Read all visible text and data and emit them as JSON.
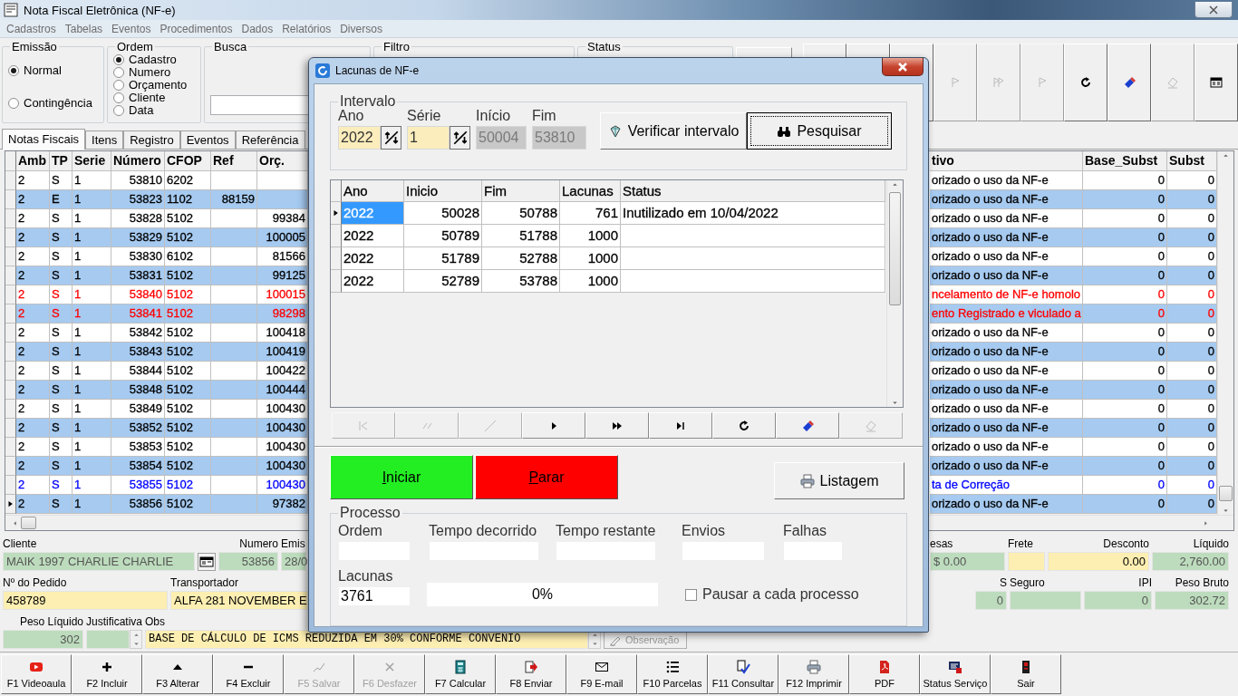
{
  "window": {
    "title": "Nota Fiscal Eletrônica (NF-e)"
  },
  "menu": [
    "Cadastros",
    "Tabelas",
    "Eventos",
    "Procedimentos",
    "Dados",
    "Relatórios",
    "Diversos"
  ],
  "emissao": {
    "label": "Emissão",
    "options": [
      {
        "label": "Normal",
        "selected": true
      },
      {
        "label": "Contingência",
        "selected": false
      }
    ]
  },
  "ordem": {
    "label": "Ordem",
    "options": [
      {
        "label": "Cadastro",
        "selected": true
      },
      {
        "label": "Numero",
        "selected": false
      },
      {
        "label": "Orçamento",
        "selected": false
      },
      {
        "label": "Cliente",
        "selected": false
      },
      {
        "label": "Data",
        "selected": false
      }
    ]
  },
  "busca": {
    "label": "Busca"
  },
  "filtro": {
    "label": "Filtro"
  },
  "status": {
    "label": "Status"
  },
  "nav_buttons": [
    {
      "disabled": true
    },
    {
      "disabled": true
    },
    {
      "disabled": true
    },
    {
      "disabled": false
    },
    {
      "disabled": false
    },
    {
      "disabled": true
    },
    {
      "disabled": false
    }
  ],
  "tabs": [
    {
      "label": "Notas Fiscais",
      "selected": true
    },
    {
      "label": "Itens",
      "selected": false
    },
    {
      "label": "Registro",
      "selected": false
    },
    {
      "label": "Eventos",
      "selected": false
    },
    {
      "label": "Referência",
      "selected": false
    }
  ],
  "grid": {
    "columns": [
      "Amb",
      "TP",
      "Serie",
      "Número",
      "CFOP",
      "Ref",
      "Orç.",
      "tivo",
      "Base_Subst",
      "Subst"
    ],
    "rows": [
      {
        "cells": [
          "2",
          "S",
          "1",
          "53810",
          "6202",
          null,
          null,
          "orizado o uso da NF-e",
          "0",
          "0"
        ],
        "color": "#000000",
        "selected": false
      },
      {
        "cells": [
          "2",
          "E",
          "1",
          "53823",
          "1102",
          "88159",
          null,
          "orizado o uso da NF-e",
          "0",
          "0"
        ],
        "color": "#000000",
        "selected": false
      },
      {
        "cells": [
          "2",
          "S",
          "1",
          "53828",
          "5102",
          null,
          "99384",
          "orizado o uso da NF-e",
          "0",
          "0"
        ],
        "color": "#000000",
        "selected": false
      },
      {
        "cells": [
          "2",
          "S",
          "1",
          "53829",
          "5102",
          null,
          "100005",
          "orizado o uso da NF-e",
          "0",
          "0"
        ],
        "color": "#000000",
        "selected": false
      },
      {
        "cells": [
          "2",
          "S",
          "1",
          "53830",
          "6102",
          null,
          "81566",
          "orizado o uso da NF-e",
          "0",
          "0"
        ],
        "color": "#000000",
        "selected": false
      },
      {
        "cells": [
          "2",
          "S",
          "1",
          "53831",
          "5102",
          null,
          "99125",
          "orizado o uso da NF-e",
          "0",
          "0"
        ],
        "color": "#000000",
        "selected": false
      },
      {
        "cells": [
          "2",
          "S",
          "1",
          "53840",
          "5102",
          null,
          "100015",
          "ncelamento de NF-e homolo",
          "0",
          "0"
        ],
        "color": "#ff0000",
        "selected": false
      },
      {
        "cells": [
          "2",
          "S",
          "1",
          "53841",
          "5102",
          null,
          "98298",
          "ento Registrado e viculado a",
          "0",
          "0"
        ],
        "color": "#ff0000",
        "selected": false
      },
      {
        "cells": [
          "2",
          "S",
          "1",
          "53842",
          "5102",
          null,
          "100418",
          "orizado o uso da NF-e",
          "0",
          "0"
        ],
        "color": "#000000",
        "selected": false
      },
      {
        "cells": [
          "2",
          "S",
          "1",
          "53843",
          "5102",
          null,
          "100419",
          "orizado o uso da NF-e",
          "0",
          "0"
        ],
        "color": "#000000",
        "selected": false
      },
      {
        "cells": [
          "2",
          "S",
          "1",
          "53844",
          "5102",
          null,
          "100422",
          "orizado o uso da NF-e",
          "0",
          "0"
        ],
        "color": "#000000",
        "selected": false
      },
      {
        "cells": [
          "2",
          "S",
          "1",
          "53848",
          "5102",
          null,
          "100444",
          "orizado o uso da NF-e",
          "0",
          "0"
        ],
        "color": "#000000",
        "selected": false
      },
      {
        "cells": [
          "2",
          "S",
          "1",
          "53849",
          "5102",
          null,
          "100430",
          "orizado o uso da NF-e",
          "0",
          "0"
        ],
        "color": "#000000",
        "selected": false
      },
      {
        "cells": [
          "2",
          "S",
          "1",
          "53852",
          "5102",
          null,
          "100430",
          "orizado o uso da NF-e",
          "0",
          "0"
        ],
        "color": "#000000",
        "selected": false
      },
      {
        "cells": [
          "2",
          "S",
          "1",
          "53853",
          "5102",
          null,
          "100430",
          "orizado o uso da NF-e",
          "0",
          "0"
        ],
        "color": "#000000",
        "selected": false
      },
      {
        "cells": [
          "2",
          "S",
          "1",
          "53854",
          "5102",
          null,
          "100430",
          "orizado o uso da NF-e",
          "0",
          "0"
        ],
        "color": "#000000",
        "selected": false
      },
      {
        "cells": [
          "2",
          "S",
          "1",
          "53855",
          "5102",
          null,
          "100430",
          "ta de Correção",
          "0",
          "0"
        ],
        "color": "#0000ff",
        "selected": false
      },
      {
        "cells": [
          "2",
          "S",
          "1",
          "53856",
          "5102",
          null,
          "97382",
          "orizado o uso da NF-e",
          "0",
          "0"
        ],
        "color": "#000000",
        "selected": true
      }
    ]
  },
  "form": {
    "rows": [
      {
        "left": [
          {
            "label": "Cliente",
            "value": "MAIK 1997 CHARLIE CHARLIE",
            "kind": "readonly"
          },
          {
            "label": "Numero",
            "value": "53856",
            "kind": "readonly"
          },
          {
            "label": "Emis",
            "value": "28/0",
            "kind": "readonly"
          }
        ],
        "right": [
          {
            "label": "esas",
            "value": "$ 0.00",
            "kind": "readonly"
          },
          {
            "label": "Frete",
            "kind": "editable"
          },
          {
            "label": "Desconto",
            "value": "0.00",
            "kind": "editable"
          },
          {
            "label": "Líquido",
            "value": "2,760.00",
            "kind": "readonly"
          }
        ]
      },
      {
        "left": [
          {
            "label": "Nº do Pedido",
            "value": "458789",
            "kind": "editable"
          },
          {
            "label": "Transportador",
            "value": "ALFA 281 NOVEMBER E",
            "kind": "editable"
          }
        ],
        "right": [
          {
            "label": "S",
            "value": "0",
            "kind": "readonly"
          },
          {
            "label": "Seguro",
            "kind": "readonly"
          },
          {
            "label": "IPI",
            "value": "0",
            "kind": "readonly"
          },
          {
            "label": "Peso Bruto",
            "value": "302.72",
            "kind": "readonly"
          }
        ]
      },
      {
        "left": [
          {
            "label": "Peso Líquido",
            "value": "302",
            "kind": "readonly"
          },
          {
            "label": "Justificativa",
            "kind": "spinner"
          },
          {
            "label": "Obs",
            "value": "BASE DE CÁLCULO DE ICMS REDUZIDA EM  30%  CONFORME  CONVENIO",
            "kind": "memo"
          }
        ],
        "right": []
      }
    ],
    "observacao_button": {
      "label": "Observação",
      "disabled": true
    }
  },
  "dialog": {
    "title": "Lacunas de NF-e",
    "intervalo": {
      "label": "Intervalo",
      "ano": {
        "label": "Ano",
        "value": "2022"
      },
      "serie": {
        "label": "Série",
        "value": "1"
      },
      "inicio": {
        "label": "Início",
        "value": "50004"
      },
      "fim": {
        "label": "Fim",
        "value": "53810"
      }
    },
    "buttons": [
      {
        "label": "Verificar intervalo",
        "focused": false
      },
      {
        "label": "Pesquisar",
        "focused": true
      }
    ],
    "grid": {
      "columns": [
        "Ano",
        "Inicio",
        "Fim",
        "Lacunas",
        "Status"
      ],
      "rows": [
        {
          "cells": [
            "2022",
            "50028",
            "50788",
            "761",
            "Inutilizado em 10/04/2022"
          ],
          "selected": true
        },
        {
          "cells": [
            "2022",
            "50789",
            "51788",
            "1000",
            null
          ],
          "selected": false
        },
        {
          "cells": [
            "2022",
            "51789",
            "52788",
            "1000",
            null
          ],
          "selected": false
        },
        {
          "cells": [
            "2022",
            "52789",
            "53788",
            "1000",
            null
          ],
          "selected": false
        }
      ]
    },
    "navigator": [
      {
        "disabled": true
      },
      {
        "disabled": true
      },
      {
        "disabled": true
      },
      {
        "disabled": false
      },
      {
        "disabled": false
      },
      {
        "disabled": false
      },
      {
        "disabled": false
      },
      {
        "disabled": false
      },
      {
        "disabled": true
      }
    ],
    "actions": [
      {
        "label": "Iniciar",
        "kind": "start"
      },
      {
        "label": "Parar",
        "kind": "stop"
      }
    ],
    "listagem": {
      "label": "Listagem"
    },
    "processo": {
      "label": "Processo",
      "fields": [
        {
          "label": "Ordem"
        },
        {
          "label": "Tempo decorrido"
        },
        {
          "label": "Tempo restante"
        },
        {
          "label": "Envios"
        },
        {
          "label": "Falhas"
        }
      ],
      "lacunas": {
        "label": "Lacunas",
        "value": "3761"
      },
      "progress": {
        "level": 0,
        "text": "0%"
      },
      "pausar": {
        "label": "Pausar a cada processo",
        "checked": false
      }
    }
  },
  "toolbar": [
    {
      "label": "F1 Videoaula",
      "disabled": false
    },
    {
      "label": "F2 Incluir",
      "disabled": false
    },
    {
      "label": "F3 Alterar",
      "disabled": false
    },
    {
      "label": "F4 Excluir",
      "disabled": false
    },
    {
      "label": "F5 Salvar",
      "disabled": true
    },
    {
      "label": "F6 Desfazer",
      "disabled": true
    },
    {
      "label": "F7 Calcular",
      "disabled": false
    },
    {
      "label": "F8 Enviar",
      "disabled": false
    },
    {
      "label": "F9 E-mail",
      "disabled": false
    },
    {
      "label": "F10 Parcelas",
      "disabled": false
    },
    {
      "label": "F11 Consultar",
      "disabled": false
    },
    {
      "label": "F12 Imprimir",
      "disabled": false
    },
    {
      "label": "PDF",
      "disabled": false
    },
    {
      "label": "Status Serviço",
      "disabled": false
    },
    {
      "label": "Sair",
      "disabled": false
    }
  ]
}
